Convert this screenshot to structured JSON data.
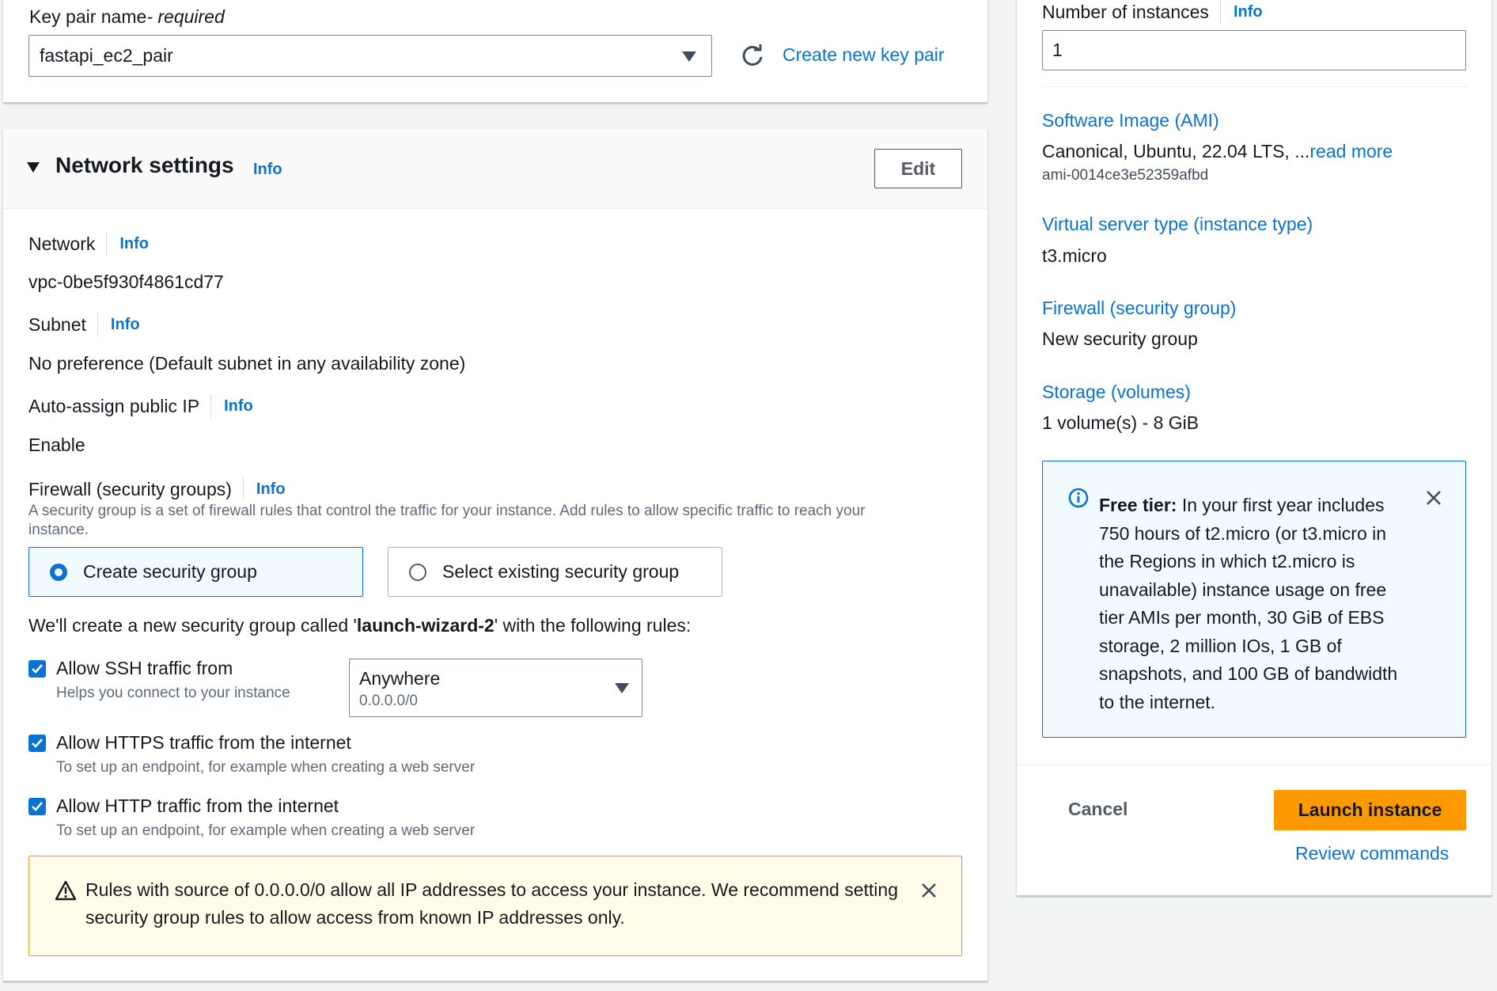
{
  "key_pair": {
    "label": "Key pair name",
    "required_suffix": " - required",
    "selected_value": "fastapi_ec2_pair",
    "create_link": "Create new key pair"
  },
  "network_settings": {
    "title": "Network settings",
    "info": "Info",
    "edit_button": "Edit",
    "network_label": "Network",
    "network_value": "vpc-0be5f930f4861cd77",
    "subnet_label": "Subnet",
    "subnet_value": "No preference (Default subnet in any availability zone)",
    "auto_ip_label": "Auto-assign public IP",
    "auto_ip_value": "Enable",
    "firewall_label": "Firewall (security groups)",
    "firewall_desc_line1": "A security group is a set of firewall rules that control the traffic for your instance. Add rules to allow specific traffic to reach your",
    "firewall_desc_line2": "instance.",
    "option_create": "Create security group",
    "option_existing": "Select existing security group",
    "create_note_prefix": "We'll create a new security group called '",
    "create_note_name": "launch-wizard-2",
    "create_note_suffix": "' with the following rules:",
    "rules": [
      {
        "label": "Allow SSH traffic from",
        "desc": "Helps you connect to your instance",
        "checked": true
      },
      {
        "label": "Allow HTTPS traffic from the internet",
        "desc": "To set up an endpoint, for example when creating a web server",
        "checked": true
      },
      {
        "label": "Allow HTTP traffic from the internet",
        "desc": "To set up an endpoint, for example when creating a web server",
        "checked": true
      }
    ],
    "ssh_source_value": "Anywhere",
    "ssh_source_cidr": "0.0.0.0/0",
    "warning_line1": "Rules with source of 0.0.0.0/0 allow all IP addresses to access your instance. We recommend setting",
    "warning_line2": "security group rules to allow access from known IP addresses only."
  },
  "summary": {
    "instances_label": "Number of instances",
    "info": "Info",
    "instances_value": "1",
    "ami_label": "Software Image (AMI)",
    "ami_value": "Canonical, Ubuntu, 22.04 LTS, ...",
    "ami_read_more": "read more",
    "ami_id": "ami-0014ce3e52359afbd",
    "instance_type_label": "Virtual server type (instance type)",
    "instance_type_value": "t3.micro",
    "firewall_label": "Firewall (security group)",
    "firewall_value": "New security group",
    "storage_label": "Storage (volumes)",
    "storage_value": "1 volume(s) - 8 GiB",
    "free_tier_title": "Free tier:",
    "free_tier_lines": [
      " In your first year includes",
      "750 hours of t2.micro (or t3.micro in",
      "the Regions in which t2.micro is",
      "unavailable) instance usage on free",
      "tier AMIs per month, 30 GiB of EBS",
      "storage, 2 million IOs, 1 GB of",
      "snapshots, and 100 GB of bandwidth",
      "to the internet."
    ],
    "cancel_button": "Cancel",
    "launch_button": "Launch instance",
    "review_link": "Review commands"
  },
  "colors": {
    "link": "#0972d3",
    "primary_button": "#ff9900",
    "warning_bg": "#fffce9",
    "info_bg": "#f1faff"
  }
}
